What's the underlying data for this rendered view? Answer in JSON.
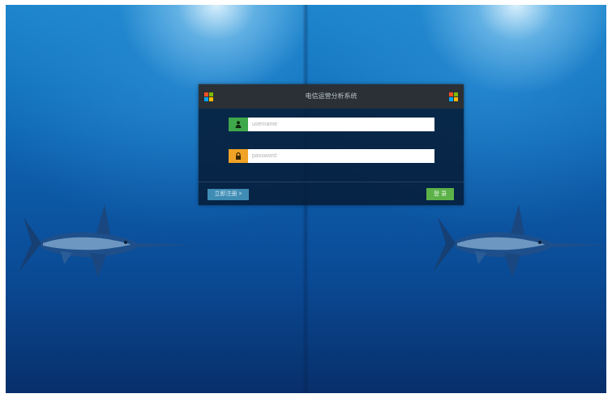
{
  "window": {
    "title": "电信运营分析系统"
  },
  "form": {
    "username_placeholder": "username",
    "password_placeholder": "password",
    "register_label": "立即注册 >",
    "login_label": "登 录"
  },
  "icons": {
    "brand": "windows-logo-icon",
    "user": "user-icon",
    "lock": "lock-icon"
  },
  "colors": {
    "user_addon": "#3fa84a",
    "password_addon": "#f0a326",
    "register_button": "#3f8cb4",
    "login_button": "#5cb248",
    "header": "#2b3036"
  }
}
